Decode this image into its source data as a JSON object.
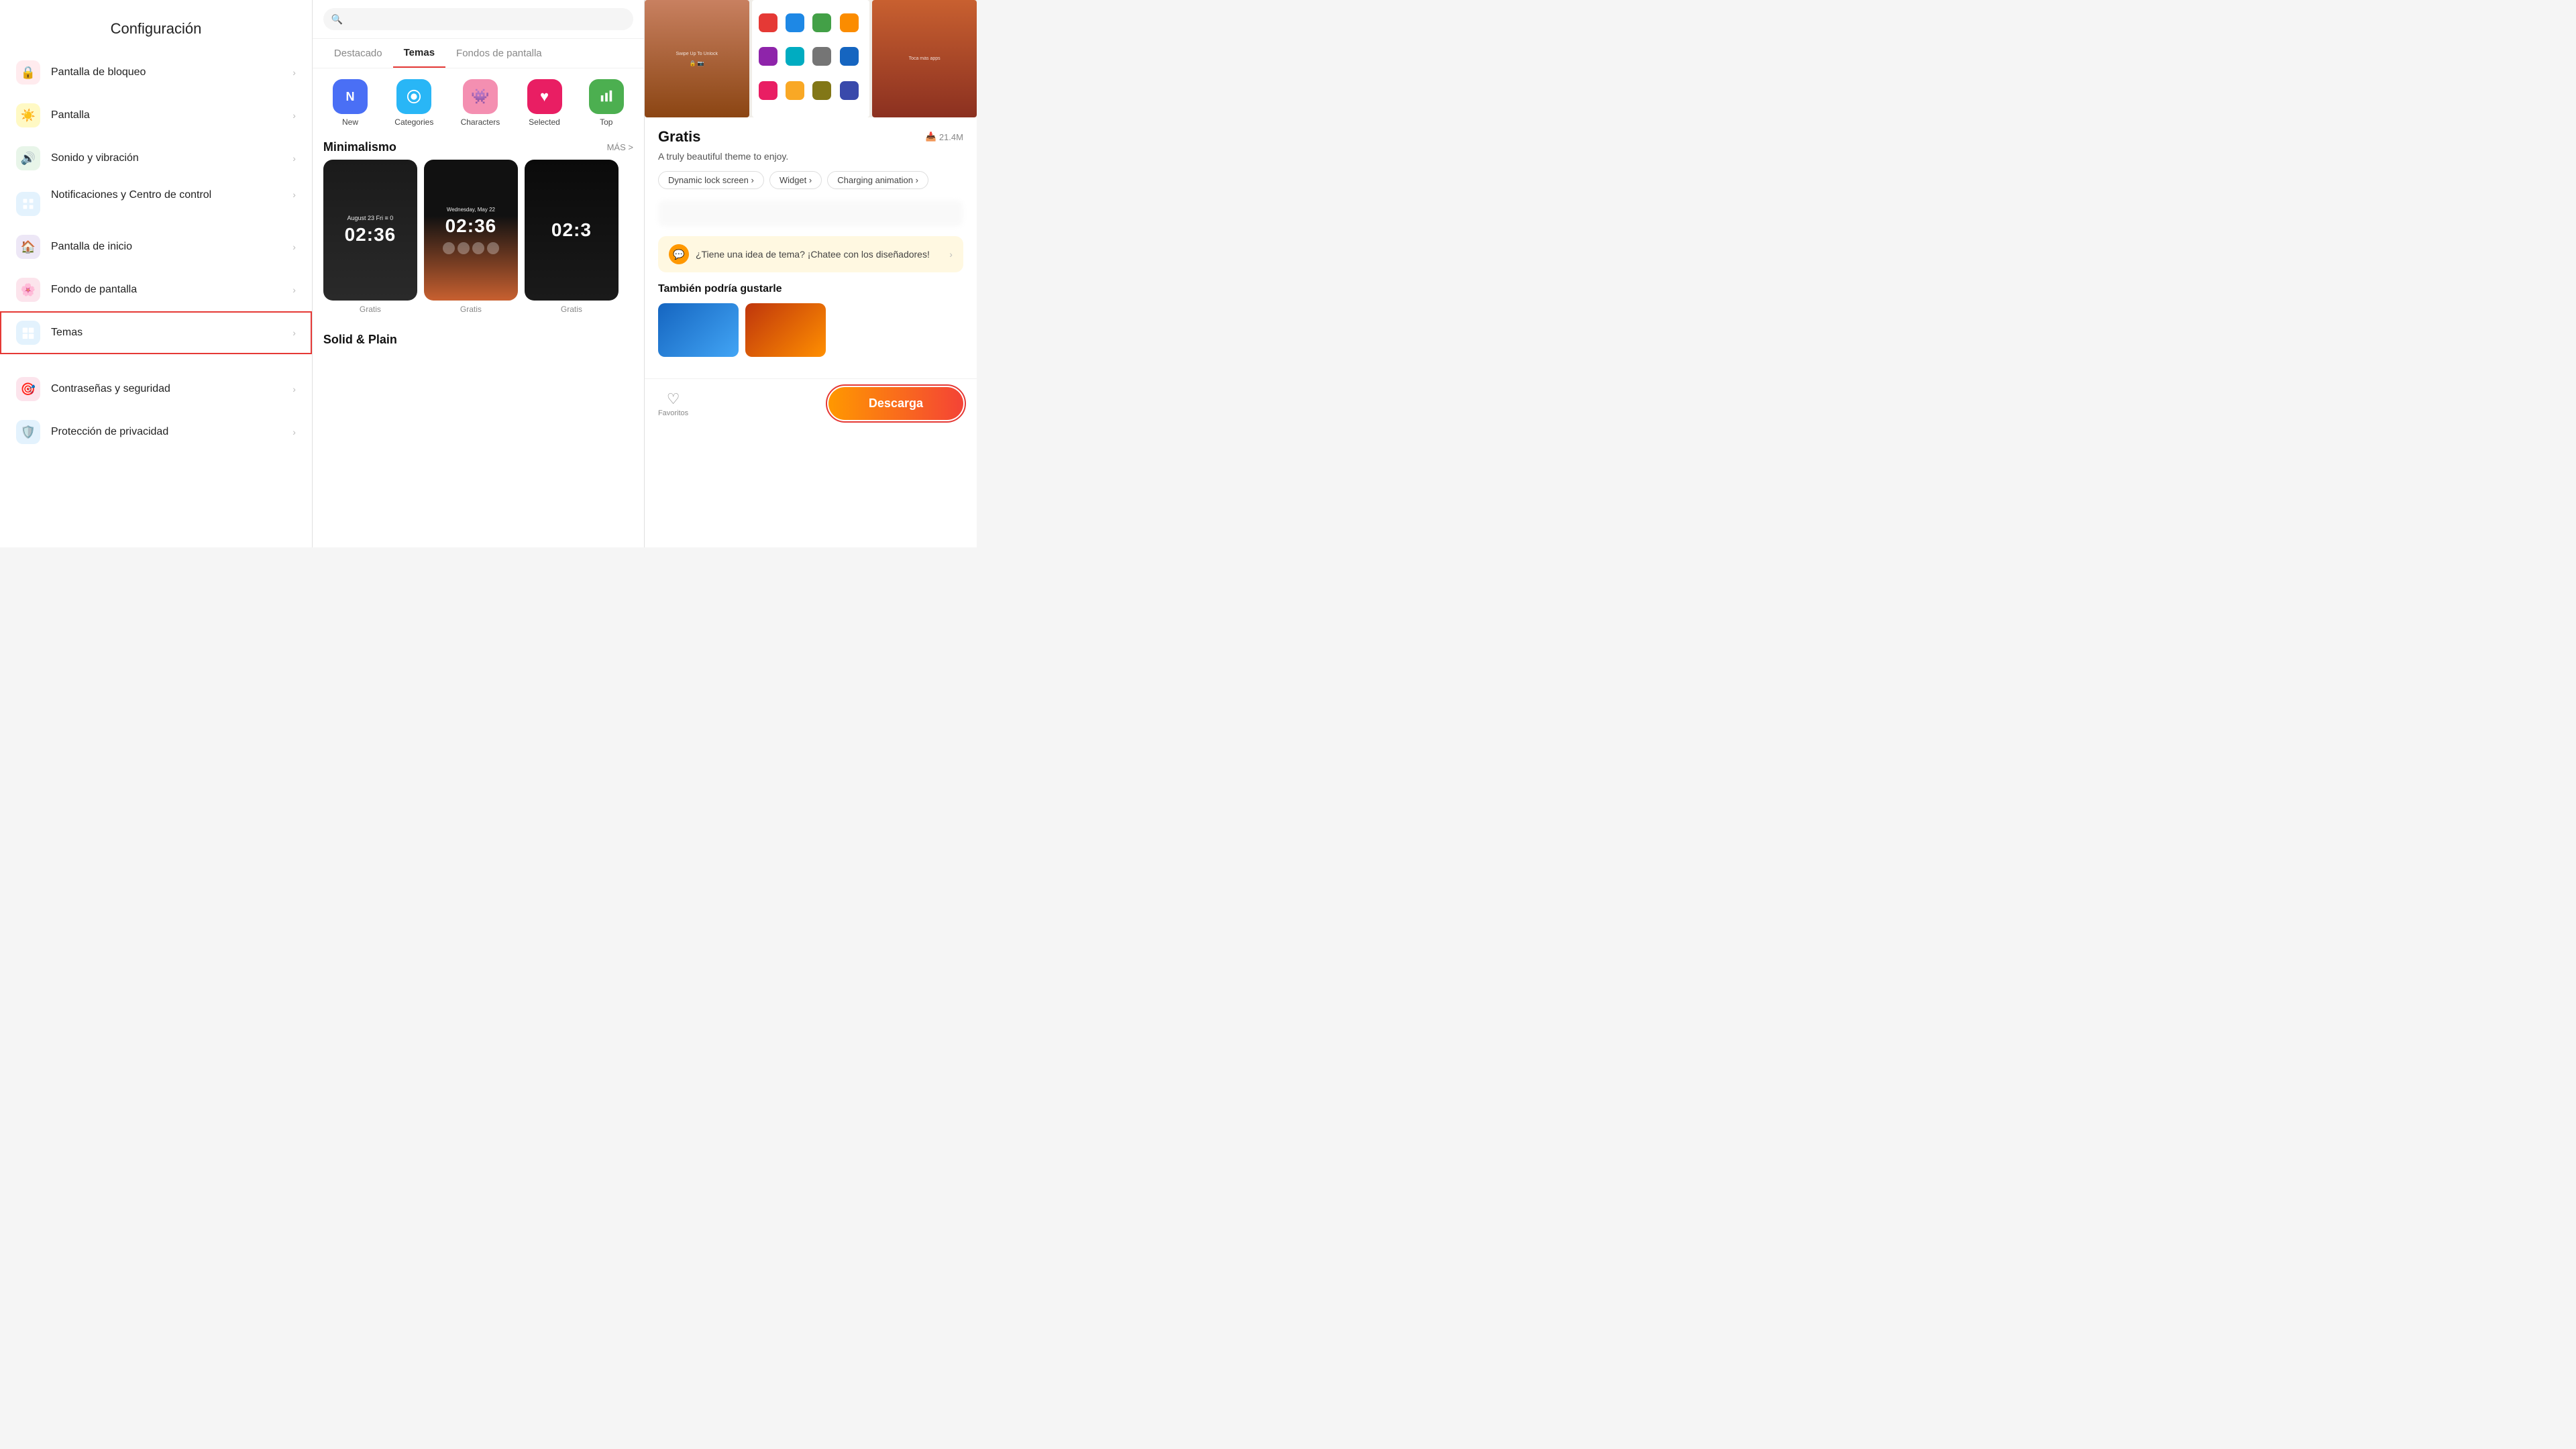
{
  "settings": {
    "title": "Configuración",
    "items": [
      {
        "id": "lock-screen",
        "label": "Pantalla de bloqueo",
        "icon": "🔒",
        "iconClass": "icon-lock"
      },
      {
        "id": "display",
        "label": "Pantalla",
        "icon": "☀️",
        "iconClass": "icon-display"
      },
      {
        "id": "sound",
        "label": "Sonido y vibración",
        "icon": "🔊",
        "iconClass": "icon-sound"
      },
      {
        "id": "notifications",
        "label": "Notificaciones y Centro de control",
        "icon": "📋",
        "iconClass": "icon-notifications",
        "multiline": true
      },
      {
        "id": "home-screen",
        "label": "Pantalla de inicio",
        "icon": "🏠",
        "iconClass": "icon-home"
      },
      {
        "id": "wallpaper",
        "label": "Fondo de pantalla",
        "icon": "🌸",
        "iconClass": "icon-wallpaper"
      },
      {
        "id": "themes",
        "label": "Temas",
        "icon": "🎨",
        "iconClass": "icon-themes",
        "active": true
      },
      {
        "id": "divider",
        "type": "divider"
      },
      {
        "id": "passwords",
        "label": "Contraseñas y seguridad",
        "icon": "🎯",
        "iconClass": "icon-password"
      },
      {
        "id": "privacy",
        "label": "Protección de privacidad",
        "icon": "🛡️",
        "iconClass": "icon-privacy"
      }
    ]
  },
  "themes_store": {
    "search_placeholder": "🔍",
    "tabs": [
      {
        "id": "destacado",
        "label": "Destacado"
      },
      {
        "id": "temas",
        "label": "Temas",
        "active": true
      },
      {
        "id": "fondos",
        "label": "Fondos de pantalla"
      }
    ],
    "categories": [
      {
        "id": "new",
        "label": "New",
        "iconClass": "cat-new",
        "icon": "N"
      },
      {
        "id": "categories",
        "label": "Categories",
        "iconClass": "cat-categories",
        "icon": "⊙"
      },
      {
        "id": "characters",
        "label": "Characters",
        "iconClass": "cat-characters",
        "icon": "👾"
      },
      {
        "id": "selected",
        "label": "Selected",
        "iconClass": "cat-selected",
        "icon": "♥"
      },
      {
        "id": "top",
        "label": "Top",
        "iconClass": "cat-top",
        "icon": "📊"
      }
    ],
    "sections": [
      {
        "id": "minimalismo",
        "title": "Minimalismo",
        "more_label": "MÁS >",
        "cards": [
          {
            "date": "August 23 Fri ≡ 0",
            "time": "02:36",
            "price": "Gratis",
            "style": "dark-1"
          },
          {
            "date": "Wednesday, May 22",
            "time": "02:36",
            "price": "Gratis",
            "style": "dark-2"
          },
          {
            "date": "",
            "time": "02:3",
            "price": "Gratis",
            "style": "dark-3"
          }
        ]
      },
      {
        "id": "solid-plain",
        "title": "Solid & Plain"
      }
    ]
  },
  "theme_detail": {
    "title": "Gratis",
    "size": "21.4M",
    "description": "A truly beautiful theme to enjoy.",
    "tags": [
      {
        "id": "dynamic-lock",
        "label": "Dynamic lock screen ›"
      },
      {
        "id": "widget",
        "label": "Widget ›"
      },
      {
        "id": "charging",
        "label": "Charging animation ›"
      }
    ],
    "chat_text": "¿Tiene una idea de tema? ¡Chatee con los diseñadores!",
    "also_like_title": "También podría gustarle",
    "favorite_label": "Favoritos",
    "download_label": "Descarga"
  }
}
